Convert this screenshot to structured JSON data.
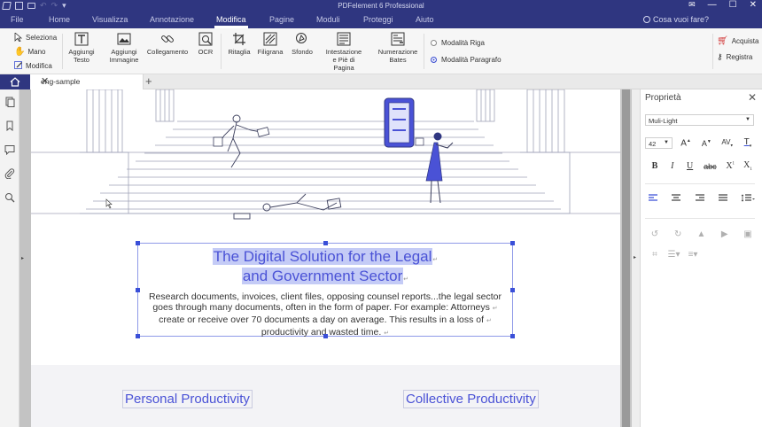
{
  "titlebar": {
    "title": "PDFelement 6 Professional",
    "minimize": "—",
    "maximize": "☐",
    "close": "✕"
  },
  "menu": {
    "items": [
      "File",
      "Home",
      "Visualizza",
      "Annotazione",
      "Modifica",
      "Pagine",
      "Moduli",
      "Proteggi",
      "Aiuto"
    ],
    "active": "Modifica",
    "help": "Cosa vuoi fare?"
  },
  "ribbon": {
    "select": "Seleziona",
    "hand": "Mano",
    "edit": "Modifica",
    "add_text": [
      "Aggiungi",
      "Testo"
    ],
    "add_image": [
      "Aggiungi",
      "Immagine"
    ],
    "link": "Collegamento",
    "ocr": "OCR",
    "crop": "Ritaglia",
    "watermark": "Filigrana",
    "background": "Sfondo",
    "header_footer": [
      "Intestazione",
      "e Piè di Pagina"
    ],
    "bates": [
      "Numerazione",
      "Bates"
    ],
    "mode_line": "Modalità Riga",
    "mode_paragraph": "Modalità Paragrafo",
    "buy": "Acquista",
    "register": "Registra"
  },
  "tabs": {
    "doc": "eng-sample",
    "close": "✕",
    "new": "+"
  },
  "page": {
    "heading_line1": "The Digital Solution for the Legal",
    "heading_line2": "and Government Sector",
    "para": [
      "Research documents, invoices, client files, opposing counsel reports...the legal sector",
      "goes through many documents, often in the form of paper. For example: Attorneys",
      "create or receive over 70 documents a day on average. This results in a loss of",
      "productivity and wasted time."
    ],
    "para_mark": "↵",
    "box_left": "Personal Productivity",
    "box_right": "Collective Productivity"
  },
  "props": {
    "title": "Proprietà",
    "close": "✕",
    "font": "Muli-Light",
    "size": "42"
  },
  "colors": {
    "titlebar": "#2f3680",
    "accent": "#3a4fd8",
    "heading_text": "#4a52d6",
    "highlight": "#c4cbf6"
  }
}
